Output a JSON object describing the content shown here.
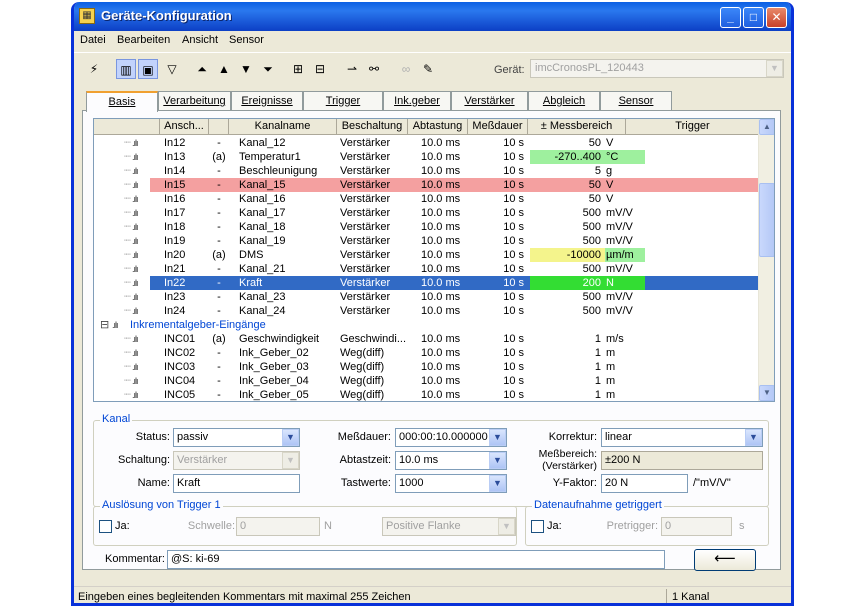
{
  "window": {
    "title": "Geräte-Konfiguration",
    "minimize": "_",
    "maximize": "□",
    "close": "✕"
  },
  "menu": [
    "Datei",
    "Bearbeiten",
    "Ansicht",
    "Sensor"
  ],
  "toolbar": {
    "geraet_label": "Gerät:",
    "geraet_value": "imcCronosPL_120443"
  },
  "tabs": [
    "Basis",
    "Verarbeitung",
    "Ereignisse",
    "Trigger",
    "Ink.geber",
    "Verstärker",
    "Abgleich",
    "Sensor"
  ],
  "table": {
    "headers": [
      "Ansch...",
      "",
      "Kanalname",
      "Beschaltung",
      "Abtastung",
      "Meßdauer",
      "± Messbereich",
      "Trigger"
    ],
    "rows": [
      {
        "ansch": "In12",
        "flag": "-",
        "name": "Kanal_12",
        "beschaltung": "Verstärker",
        "abtastung": "10.0 ms",
        "messdauer": "10 s",
        "bereich": "50",
        "unit": "V",
        "style": "normal"
      },
      {
        "ansch": "In13",
        "flag": "(a)",
        "name": "Temperatur1",
        "beschaltung": "Verstärker",
        "abtastung": "10.0 ms",
        "messdauer": "10 s",
        "bereich": "-270..400",
        "unit": "°C",
        "style": "temp"
      },
      {
        "ansch": "In14",
        "flag": "-",
        "name": "Beschleunigung",
        "beschaltung": "Verstärker",
        "abtastung": "10.0 ms",
        "messdauer": "10 s",
        "bereich": "5",
        "unit": "g",
        "style": "normal"
      },
      {
        "ansch": "In15",
        "flag": "-",
        "name": "Kanal_15",
        "beschaltung": "Verstärker",
        "abtastung": "10.0 ms",
        "messdauer": "10 s",
        "bereich": "50",
        "unit": "V",
        "style": "red"
      },
      {
        "ansch": "In16",
        "flag": "-",
        "name": "Kanal_16",
        "beschaltung": "Verstärker",
        "abtastung": "10.0 ms",
        "messdauer": "10 s",
        "bereich": "50",
        "unit": "V",
        "style": "normal"
      },
      {
        "ansch": "In17",
        "flag": "-",
        "name": "Kanal_17",
        "beschaltung": "Verstärker",
        "abtastung": "10.0 ms",
        "messdauer": "10 s",
        "bereich": "500",
        "unit": "mV/V",
        "style": "normal"
      },
      {
        "ansch": "In18",
        "flag": "-",
        "name": "Kanal_18",
        "beschaltung": "Verstärker",
        "abtastung": "10.0 ms",
        "messdauer": "10 s",
        "bereich": "500",
        "unit": "mV/V",
        "style": "normal"
      },
      {
        "ansch": "In19",
        "flag": "-",
        "name": "Kanal_19",
        "beschaltung": "Verstärker",
        "abtastung": "10.0 ms",
        "messdauer": "10 s",
        "bereich": "500",
        "unit": "mV/V",
        "style": "normal"
      },
      {
        "ansch": "In20",
        "flag": "(a)",
        "name": "DMS",
        "beschaltung": "Verstärker",
        "abtastung": "10.0 ms",
        "messdauer": "10 s",
        "bereich": "-10000",
        "unit": "µm/m",
        "style": "dms"
      },
      {
        "ansch": "In21",
        "flag": "-",
        "name": "Kanal_21",
        "beschaltung": "Verstärker",
        "abtastung": "10.0 ms",
        "messdauer": "10 s",
        "bereich": "500",
        "unit": "mV/V",
        "style": "normal"
      },
      {
        "ansch": "In22",
        "flag": "-",
        "name": "Kraft",
        "beschaltung": "Verstärker",
        "abtastung": "10.0 ms",
        "messdauer": "10 s",
        "bereich": "200",
        "unit": "N",
        "style": "sel"
      },
      {
        "ansch": "In23",
        "flag": "-",
        "name": "Kanal_23",
        "beschaltung": "Verstärker",
        "abtastung": "10.0 ms",
        "messdauer": "10 s",
        "bereich": "500",
        "unit": "mV/V",
        "style": "normal"
      },
      {
        "ansch": "In24",
        "flag": "-",
        "name": "Kanal_24",
        "beschaltung": "Verstärker",
        "abtastung": "10.0 ms",
        "messdauer": "10 s",
        "bereich": "500",
        "unit": "mV/V",
        "style": "normal"
      },
      {
        "group": "Inkrementalgeber-Eingänge"
      },
      {
        "ansch": "INC01",
        "flag": "(a)",
        "name": "Geschwindigkeit",
        "beschaltung": "Geschwindi...",
        "abtastung": "10.0 ms",
        "messdauer": "10 s",
        "bereich": "1",
        "unit": "m/s",
        "style": "normal"
      },
      {
        "ansch": "INC02",
        "flag": "-",
        "name": "Ink_Geber_02",
        "beschaltung": "Weg(diff)",
        "abtastung": "10.0 ms",
        "messdauer": "10 s",
        "bereich": "1",
        "unit": "m",
        "style": "normal"
      },
      {
        "ansch": "INC03",
        "flag": "-",
        "name": "Ink_Geber_03",
        "beschaltung": "Weg(diff)",
        "abtastung": "10.0 ms",
        "messdauer": "10 s",
        "bereich": "1",
        "unit": "m",
        "style": "normal"
      },
      {
        "ansch": "INC04",
        "flag": "-",
        "name": "Ink_Geber_04",
        "beschaltung": "Weg(diff)",
        "abtastung": "10.0 ms",
        "messdauer": "10 s",
        "bereich": "1",
        "unit": "m",
        "style": "normal"
      },
      {
        "ansch": "INC05",
        "flag": "-",
        "name": "Ink_Geber_05",
        "beschaltung": "Weg(diff)",
        "abtastung": "10.0 ms",
        "messdauer": "10 s",
        "bereich": "1",
        "unit": "m",
        "style": "normal"
      }
    ]
  },
  "kanal": {
    "legend": "Kanal",
    "status_label": "Status:",
    "status_value": "passiv",
    "schaltung_label": "Schaltung:",
    "schaltung_value": "Verstärker",
    "name_label": "Name:",
    "name_value": "Kraft",
    "messdauer_label": "Meßdauer:",
    "messdauer_value": "000:00:10.000000",
    "abtastzeit_label": "Abtastzeit:",
    "abtastzeit_value": "10.0 ms",
    "tastwerte_label": "Tastwerte:",
    "tastwerte_value": "1000",
    "korrektur_label": "Korrektur:",
    "korrektur_value": "linear",
    "messbereich_label1": "Meßbereich:",
    "messbereich_label2": "(Verstärker)",
    "messbereich_value": "±200 N",
    "yfaktor_label": "Y-Faktor:",
    "yfaktor_value": "20 N",
    "yfaktor_unit": "/\"mV/V\""
  },
  "trigger": {
    "legend": "Auslösung von Trigger 1",
    "ja_label": "Ja:",
    "schwelle_label": "Schwelle:",
    "schwelle_value": "0",
    "schwelle_unit": "N",
    "flanke_value": "Positive Flanke"
  },
  "datenaufnahme": {
    "legend": "Datenaufnahme getriggert",
    "ja_label": "Ja:",
    "pretrigger_label": "Pretrigger:",
    "pretrigger_value": "0",
    "pretrigger_unit": "s"
  },
  "kommentar": {
    "label": "Kommentar:",
    "value": "@S: ki-69",
    "enter_glyph": "⟵"
  },
  "status": {
    "left": "Eingeben eines begleitenden Kommentars mit maximal 255 Zeichen",
    "right": "1 Kanal"
  },
  "colors": {
    "temp_bg": "#9ef09e",
    "dms_bg": "#f4f48c",
    "dms_unit_bg": "#9ef09e",
    "sel_bereich_bg": "#33dd33",
    "red_row": "#f4a0a0",
    "selected_row": "#316ac5"
  }
}
